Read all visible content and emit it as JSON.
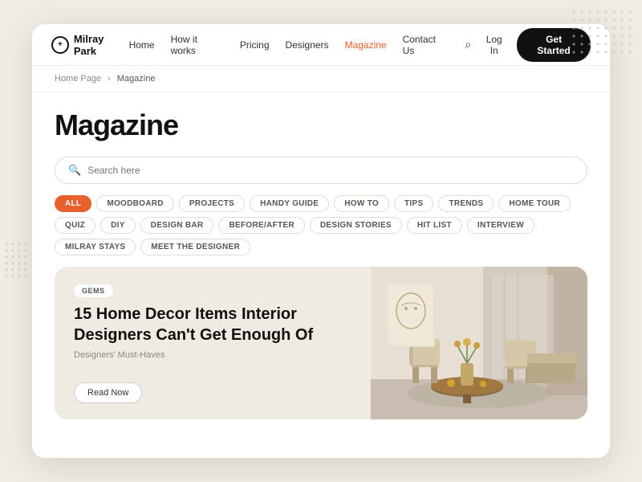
{
  "meta": {
    "bg_color": "#f0ece4"
  },
  "logo": {
    "name": "Milray Park",
    "icon": "+"
  },
  "nav": {
    "links": [
      {
        "label": "Home",
        "active": false
      },
      {
        "label": "How it works",
        "active": false
      },
      {
        "label": "Pricing",
        "active": false
      },
      {
        "label": "Designers",
        "active": false
      },
      {
        "label": "Magazine",
        "active": true
      },
      {
        "label": "Contact Us",
        "active": false
      }
    ],
    "login_label": "Log In",
    "get_started_label": "Get Started"
  },
  "breadcrumb": {
    "items": [
      "Home Page",
      "Magazine"
    ]
  },
  "magazine": {
    "title": "Magazine",
    "search_placeholder": "Search here",
    "tags": [
      {
        "label": "ALL",
        "active": true
      },
      {
        "label": "MOODBOARD",
        "active": false
      },
      {
        "label": "PROJECTS",
        "active": false
      },
      {
        "label": "HANDY GUIDE",
        "active": false
      },
      {
        "label": "HOW TO",
        "active": false
      },
      {
        "label": "TIPS",
        "active": false
      },
      {
        "label": "TRENDS",
        "active": false
      },
      {
        "label": "HOME TOUR",
        "active": false
      },
      {
        "label": "QUIZ",
        "active": false
      },
      {
        "label": "DIY",
        "active": false
      },
      {
        "label": "DESIGN BAR",
        "active": false
      },
      {
        "label": "BEFORE/AFTER",
        "active": false
      },
      {
        "label": "DESIGN STORIES",
        "active": false
      },
      {
        "label": "HIT LIST",
        "active": false
      },
      {
        "label": "INTERVIEW",
        "active": false
      },
      {
        "label": "MILRAY STAYS",
        "active": false
      },
      {
        "label": "MEET THE DESIGNER",
        "active": false
      }
    ]
  },
  "featured_article": {
    "badge": "GEMS",
    "title": "15 Home Decor Items Interior Designers Can't Get Enough Of",
    "subtitle": "Designers' Must-Haves",
    "read_now_label": "Read Now"
  }
}
